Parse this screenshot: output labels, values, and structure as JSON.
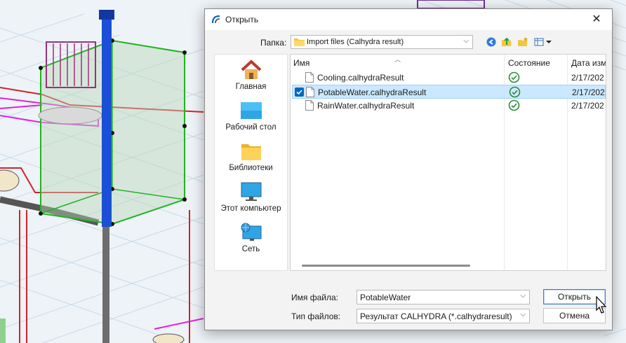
{
  "dialog": {
    "title": "Открыть",
    "close_glyph": "✕",
    "lookin_label": "Папка:",
    "lookin_value": "Import files (Calhydra result)",
    "toolbar_icons": [
      "back-icon",
      "up-folder-icon",
      "new-folder-icon",
      "view-menu-icon"
    ]
  },
  "places": [
    {
      "label": "Главная",
      "icon": "home-icon"
    },
    {
      "label": "Рабочий стол",
      "icon": "desktop-icon"
    },
    {
      "label": "Библиотеки",
      "icon": "libraries-icon"
    },
    {
      "label": "Этот компьютер",
      "icon": "this-pc-icon"
    },
    {
      "label": "Сеть",
      "icon": "network-icon"
    }
  ],
  "columns": {
    "name": "Имя",
    "status": "Состояние",
    "date": "Дата изме"
  },
  "files": [
    {
      "name": "Cooling.calhydraResult",
      "date": "2/17/202",
      "selected": false
    },
    {
      "name": "PotableWater.calhydraResult",
      "date": "2/17/202",
      "selected": true
    },
    {
      "name": "RainWater.calhydraResult",
      "date": "2/17/202",
      "selected": false
    }
  ],
  "filename_label": "Имя файла:",
  "filename_value": "PotableWater",
  "filetype_label": "Тип файлов:",
  "filetype_value": "Результат CALHYDRA (*.calhydraresult)",
  "open_button": "Открыть",
  "cancel_button": "Отмена",
  "colors": {
    "accent": "#0067c0",
    "selection": "#cce8ff",
    "status_ok": "#2e8b3c"
  }
}
